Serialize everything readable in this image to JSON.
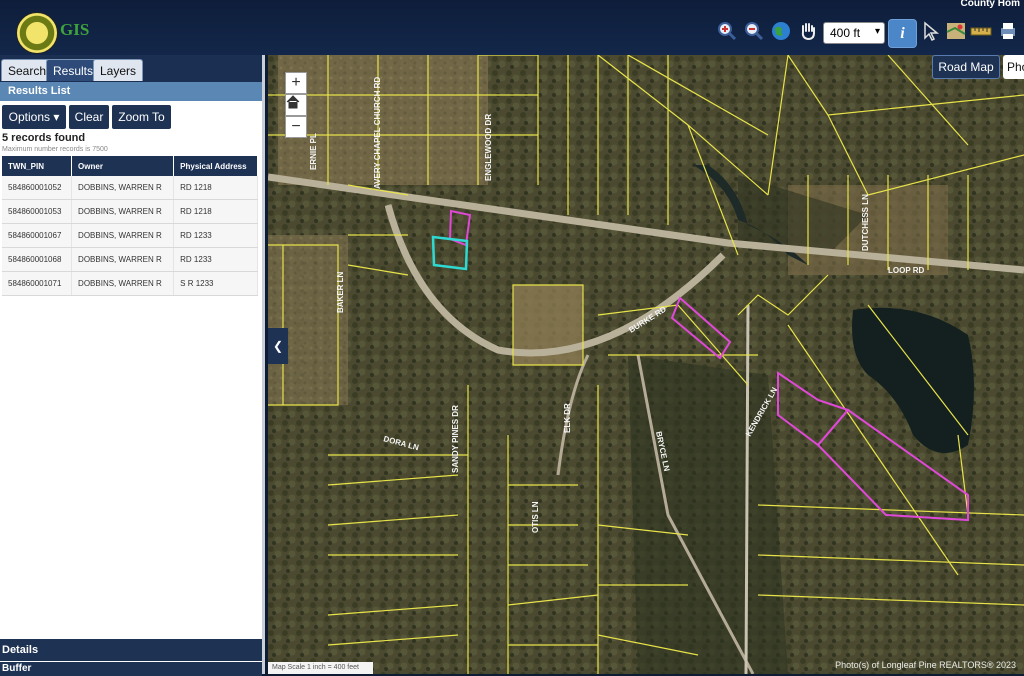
{
  "header": {
    "app_name": "GIS",
    "county_home": "County Hom",
    "zoom_scale": "400 ft"
  },
  "tabs": [
    {
      "label": "Search"
    },
    {
      "label": "Results"
    },
    {
      "label": "Layers"
    }
  ],
  "results": {
    "title": "Results List",
    "buttons": {
      "options": "Options ▾",
      "clear": "Clear",
      "zoom_to": "Zoom To"
    },
    "records_found": "5 records found",
    "max_records": "Maximum number records is 7500",
    "columns": [
      "TWN_PIN",
      "Owner",
      "Physical Address"
    ],
    "rows": [
      [
        "584860001052",
        "DOBBINS, WARREN R",
        "RD 1218"
      ],
      [
        "584860001053",
        "DOBBINS, WARREN R",
        "RD 1218"
      ],
      [
        "584860001067",
        "DOBBINS, WARREN R",
        "RD 1233"
      ],
      [
        "584860001068",
        "DOBBINS, WARREN R",
        "RD 1233"
      ],
      [
        "584860001071",
        "DOBBINS, WARREN R",
        "S R 1233"
      ]
    ]
  },
  "bottom_panels": {
    "details": "Details",
    "buffer": "Buffer"
  },
  "map": {
    "road_map_button": "Road Map",
    "photo_button": "Pho",
    "scale_text": "Map Scale 1 inch = 400 feet",
    "copyright": "Photo(s) of Longleaf Pine REALTORS® 2023",
    "road_labels": {
      "ernie": "ERNIE PL",
      "avery": "AVERY CHAPEL CHURCH RD",
      "englewood": "ENGLEWOOD DR",
      "dutchess": "DUTCHESS LN",
      "loop": "LOOP RD",
      "baker": "BAKER LN",
      "burke": "BURKE RD",
      "kendrick": "KENDRICK LN",
      "dora": "DORA LN",
      "sandy": "SANDY PINES DR",
      "elk": "ELK DR",
      "bryce": "BRYCE LN",
      "otis": "OTIS LN"
    }
  }
}
